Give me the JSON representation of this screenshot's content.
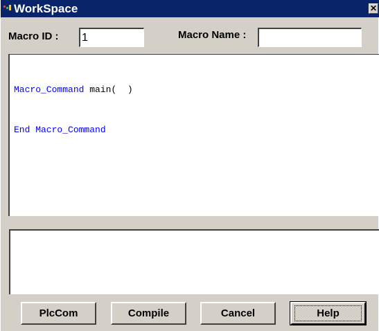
{
  "window": {
    "title": "WorkSpace",
    "close_glyph": "✕"
  },
  "form": {
    "macro_id_label": "Macro ID :",
    "macro_id_value": "1",
    "macro_name_label": "Macro Name :",
    "macro_name_value": ""
  },
  "editor": {
    "line1_keyword": "Macro_Command",
    "line1_text": " main(  )",
    "line2_keyword": "End Macro_Command"
  },
  "output": {
    "text": ""
  },
  "buttons": {
    "plccom": "PlcCom",
    "compile": "Compile",
    "cancel": "Cancel",
    "help": "Help"
  },
  "colors": {
    "titlebar": "#0a246a",
    "keyword": "#0000ff",
    "face": "#d4d0c8"
  },
  "icons": {
    "app": "app-icon",
    "close": "close-icon"
  }
}
